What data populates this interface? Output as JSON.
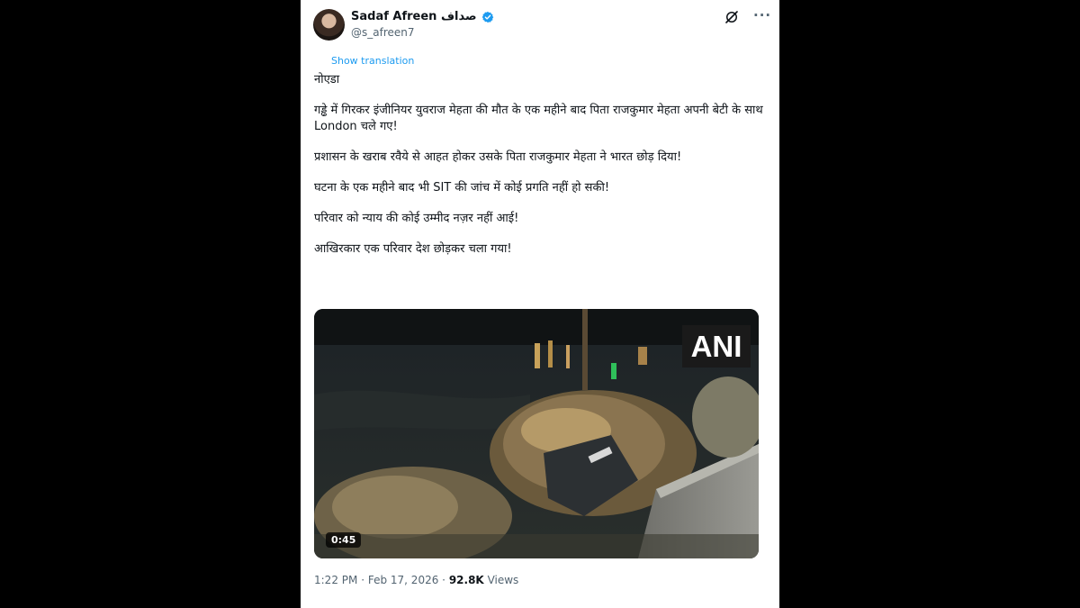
{
  "author": {
    "name": "Sadaf Afreen صداف",
    "handle": "@s_afreen7",
    "verified": true
  },
  "actions": {
    "grok_icon": "grok-icon",
    "more_icon": "more-icon",
    "more_label": "···"
  },
  "show_translation": "Show translation",
  "tweet": {
    "line1": "नोएडा",
    "para1": "गड्ढे में गिरकर इंजीनियर युवराज मेहता की मौत के एक महीने बाद पिता राजकुमार मेहता अपनी बेटी के साथ London चले गए!",
    "para2": "प्रशासन के खराब रवैये से आहत होकर उसके पिता राजकुमार मेहता ने भारत छोड़ दिया!",
    "para3": "घटना के एक महीने बाद भी SIT की जांच में कोई प्रगति नहीं हो सकी!",
    "para4": "परिवार को न्याय की कोई उम्मीद नज़र नहीं आई!",
    "para5": "आखिरकार एक परिवार देश छोड़कर चला गया!"
  },
  "media": {
    "watermark": "ANI",
    "duration": "0:45"
  },
  "meta": {
    "time": "1:22 PM",
    "separator": "·",
    "date": "Feb 17, 2026",
    "views_count": "92.8K",
    "views_label": "Views"
  },
  "colors": {
    "link": "#1d9bf0",
    "verified": "#1d9bf0",
    "text": "#0f1419",
    "muted": "#536471"
  }
}
